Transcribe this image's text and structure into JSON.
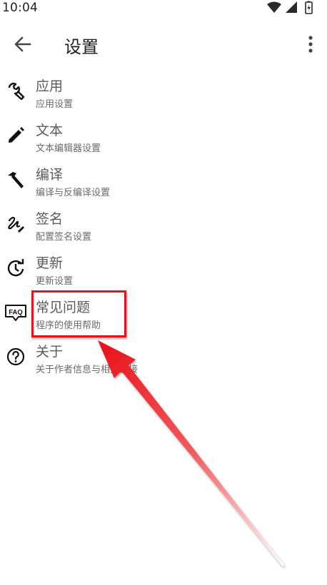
{
  "status": {
    "time": "10:04",
    "wifi_icon": "wifi-icon",
    "signal_icon": "signal-icon",
    "battery_icon": "battery-icon"
  },
  "header": {
    "title": "设置",
    "back_icon": "back-arrow-icon",
    "more_icon": "more-vert-icon"
  },
  "settings": [
    {
      "title": "应用",
      "subtitle": "应用设置",
      "icon": "wrench-icon"
    },
    {
      "title": "文本",
      "subtitle": "文本编辑器设置",
      "icon": "pencil-icon"
    },
    {
      "title": "编译",
      "subtitle": "编译与反编译设置",
      "icon": "hammer-icon"
    },
    {
      "title": "签名",
      "subtitle": "配置签名设置",
      "icon": "signature-icon"
    },
    {
      "title": "更新",
      "subtitle": "更新设置",
      "icon": "update-icon"
    },
    {
      "title": "常见问题",
      "subtitle": "程序的使用帮助",
      "icon": "faq-icon"
    },
    {
      "title": "关于",
      "subtitle": "关于作者信息与相关链接",
      "icon": "help-circle-icon"
    }
  ],
  "annotation": {
    "highlight_color": "#e8121b",
    "arrow_color": "#e8121b"
  }
}
